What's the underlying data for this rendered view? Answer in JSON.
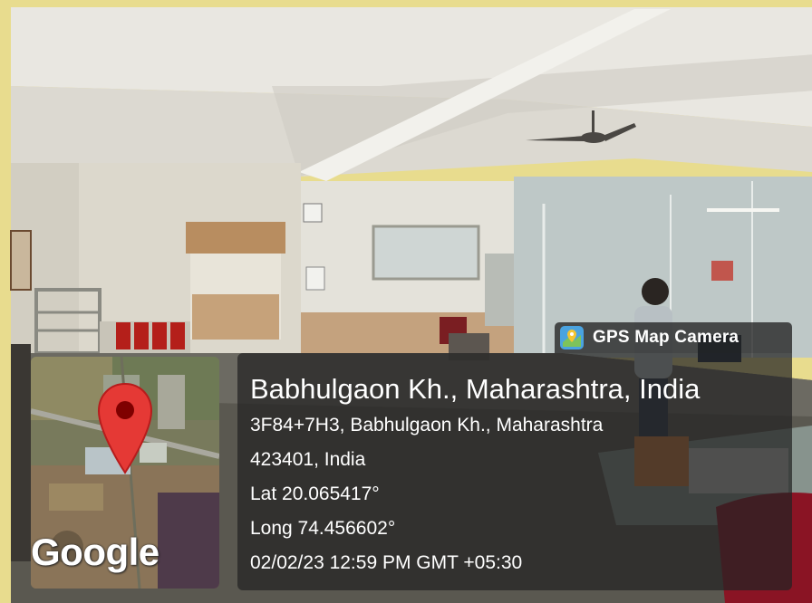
{
  "app": {
    "name": "GPS Map Camera",
    "icon": "map-pin-app-icon"
  },
  "location": {
    "title": "Babhulgaon Kh., Maharashtra, India",
    "address_line1": "3F84+7H3, Babhulgaon Kh., Maharashtra",
    "address_line2": "423401, India",
    "latitude": "Lat 20.065417°",
    "longitude": "Long 74.456602°",
    "timestamp": "02/02/23 12:59 PM GMT +05:30"
  },
  "map": {
    "attribution": "Google",
    "pin_color": "#e53935"
  }
}
